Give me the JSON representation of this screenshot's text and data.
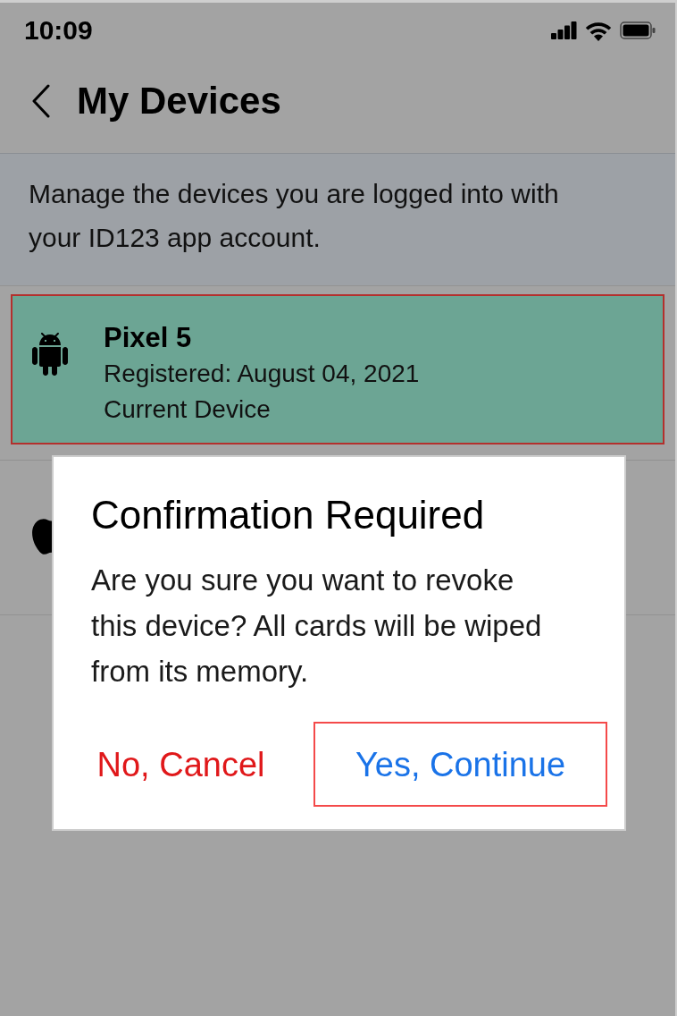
{
  "status_bar": {
    "time": "10:09"
  },
  "header": {
    "title": "My Devices"
  },
  "description": "Manage the devices you are logged into with your ID123 app account.",
  "devices": [
    {
      "kind": "android",
      "name": "Pixel 5",
      "registered": "Registered: August 04, 2021",
      "status": "Current Device",
      "selected": true
    },
    {
      "kind": "apple",
      "selected": false
    }
  ],
  "dialog": {
    "title": "Confirmation Required",
    "message": "Are you sure you want to revoke this device? All cards will be wiped from its memory.",
    "buttons": [
      {
        "label": "No, Cancel",
        "kind": "cancel",
        "focused": false
      },
      {
        "label": "Yes, Continue",
        "kind": "confirm",
        "focused": true
      }
    ]
  }
}
